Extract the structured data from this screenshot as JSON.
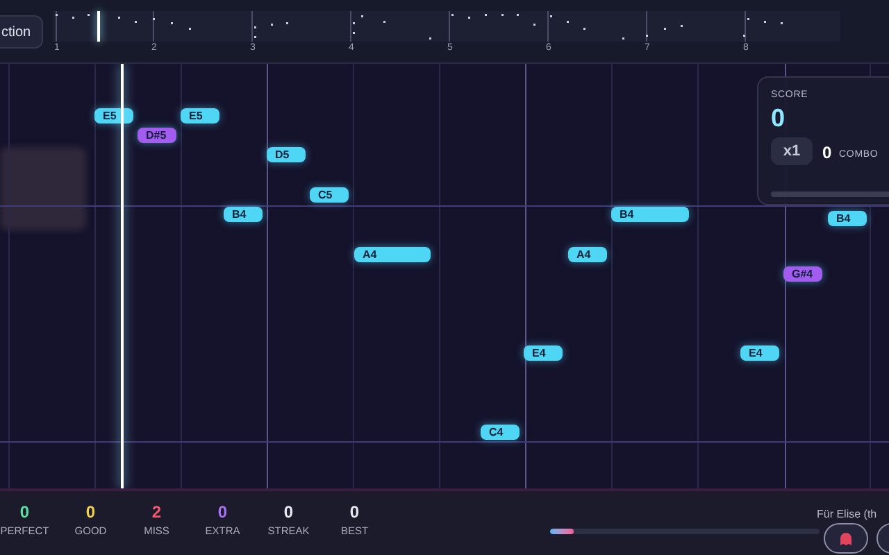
{
  "header": {
    "button": "ction",
    "measures": [
      "1",
      "2",
      "3",
      "4",
      "5",
      "6",
      "7",
      "8"
    ]
  },
  "notes": [
    {
      "label": "E5",
      "color": "#4fd6f5"
    },
    {
      "label": "E5",
      "color": "#4fd6f5"
    },
    {
      "label": "D#5",
      "color": "#a35cf0"
    },
    {
      "label": "D5",
      "color": "#4fd6f5"
    },
    {
      "label": "C5",
      "color": "#4fd6f5"
    },
    {
      "label": "B4",
      "color": "#4fd6f5"
    },
    {
      "label": "A4",
      "color": "#4fd6f5"
    },
    {
      "label": "A4",
      "color": "#4fd6f5"
    },
    {
      "label": "B4",
      "color": "#4fd6f5"
    },
    {
      "label": "B4",
      "color": "#4fd6f5"
    },
    {
      "label": "G#4",
      "color": "#a35cf0"
    },
    {
      "label": "E4",
      "color": "#4fd6f5"
    },
    {
      "label": "E4",
      "color": "#4fd6f5"
    },
    {
      "label": "C4",
      "color": "#4fd6f5"
    }
  ],
  "score_panel": {
    "label": "SCORE",
    "score": "0",
    "multiplier": "x1",
    "combo": "0",
    "combo_label": "COMBO"
  },
  "stats": [
    {
      "value": "0",
      "label": "PERFECT",
      "color": "#5ee0a0"
    },
    {
      "value": "0",
      "label": "GOOD",
      "color": "#f2d24a"
    },
    {
      "value": "2",
      "label": "MISS",
      "color": "#f0566e"
    },
    {
      "value": "0",
      "label": "EXTRA",
      "color": "#a772f5"
    },
    {
      "value": "0",
      "label": "STREAK",
      "color": "#e8e8f0"
    },
    {
      "value": "0",
      "label": "BEST",
      "color": "#e8e8f0"
    }
  ],
  "song": {
    "title": "Für Elise (th",
    "level": 0.09
  }
}
